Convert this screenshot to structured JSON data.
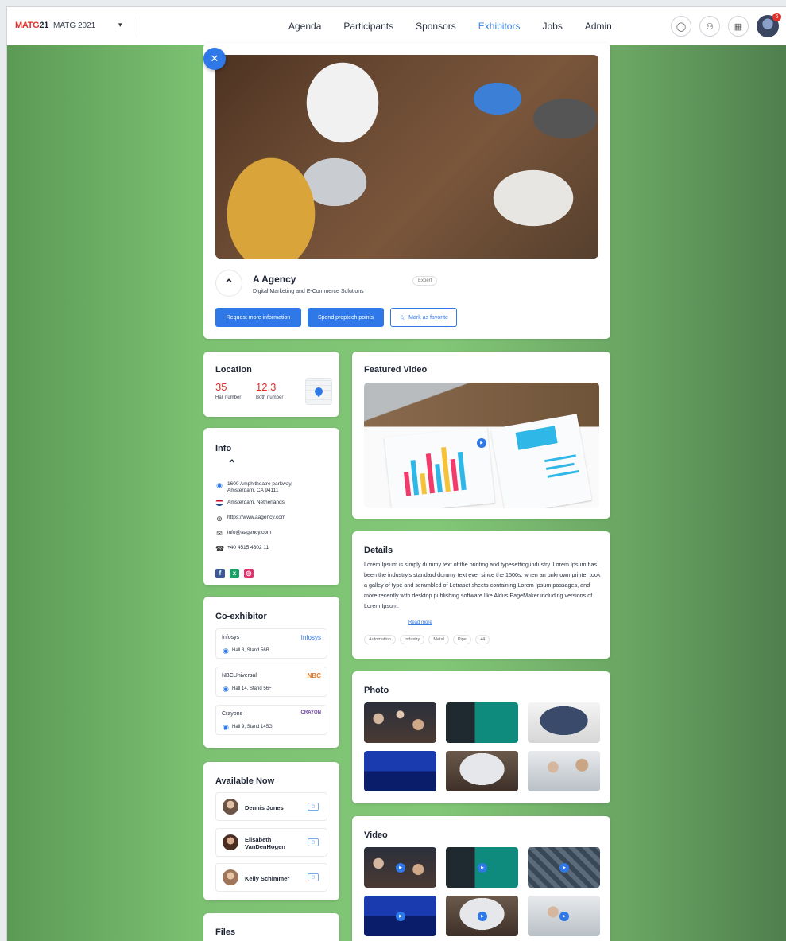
{
  "header": {
    "logo_text": "MATG",
    "logo_num": "21",
    "event_name": "MATG 2021",
    "nav": [
      {
        "label": "Agenda",
        "active": false
      },
      {
        "label": "Participants",
        "active": false
      },
      {
        "label": "Sponsors",
        "active": false
      },
      {
        "label": "Exhibitors",
        "active": true
      },
      {
        "label": "Jobs",
        "active": false
      },
      {
        "label": "Admin",
        "active": false
      }
    ],
    "notification_count": "6",
    "accent": "#3f83e0"
  },
  "exhibitor": {
    "name": "A Agency",
    "tagline": "Digital Marketing and E-Commerce Solutions",
    "badge": "Expert",
    "buttons": {
      "request_info": "Request more information",
      "spend_points": "Spend proptech points",
      "favorite": "Mark as favorite"
    }
  },
  "location": {
    "title": "Location",
    "hall_number": "35",
    "hall_label": "Hall number",
    "booth_number": "12.3",
    "booth_label": "Both number"
  },
  "info": {
    "title": "Info",
    "address": "1600 Amphitheatre parkway, Amsterdam, CA 94111",
    "country": "Amsterdam, Netherlands",
    "website": "https://www.aagency.com",
    "email": "info@aagency.com",
    "phone": "+40 4515 4302 11"
  },
  "coexhibitors": {
    "title": "Co-exhibitor",
    "items": [
      {
        "name": "Infosys",
        "logo": "Infosys",
        "location": "Hall 3, Stand 56B"
      },
      {
        "name": "NBCUniversal",
        "logo": "NBC",
        "location": "Hall 14, Stand 56F"
      },
      {
        "name": "Crayons",
        "logo": "CRAYON",
        "location": "Hall 9, Stand 145G"
      }
    ]
  },
  "available": {
    "title": "Available Now",
    "people": [
      {
        "name": "Dennis Jones"
      },
      {
        "name": "Elisabeth VanDenHogen"
      },
      {
        "name": "Kelly Schimmer"
      }
    ]
  },
  "files": {
    "title": "Files"
  },
  "featured_video": {
    "title": "Featured Video"
  },
  "details": {
    "title": "Details",
    "text": "Lorem Ipsum is simply dummy text of the printing and typesetting industry. Lorem Ipsum has been the industry's standard dummy text ever since the 1500s, when an unknown printer took a galley of type and scrambled of Letraset sheets containing Lorem Ipsum passages, and more recently with desktop publishing software like Aldus PageMaker including versions of Lorem Ipsum.",
    "read_more": "Read more",
    "tags": [
      "Automation",
      "Industry",
      "Metal",
      "Pipe",
      "+4"
    ]
  },
  "photo": {
    "title": "Photo"
  },
  "video": {
    "title": "Video"
  }
}
